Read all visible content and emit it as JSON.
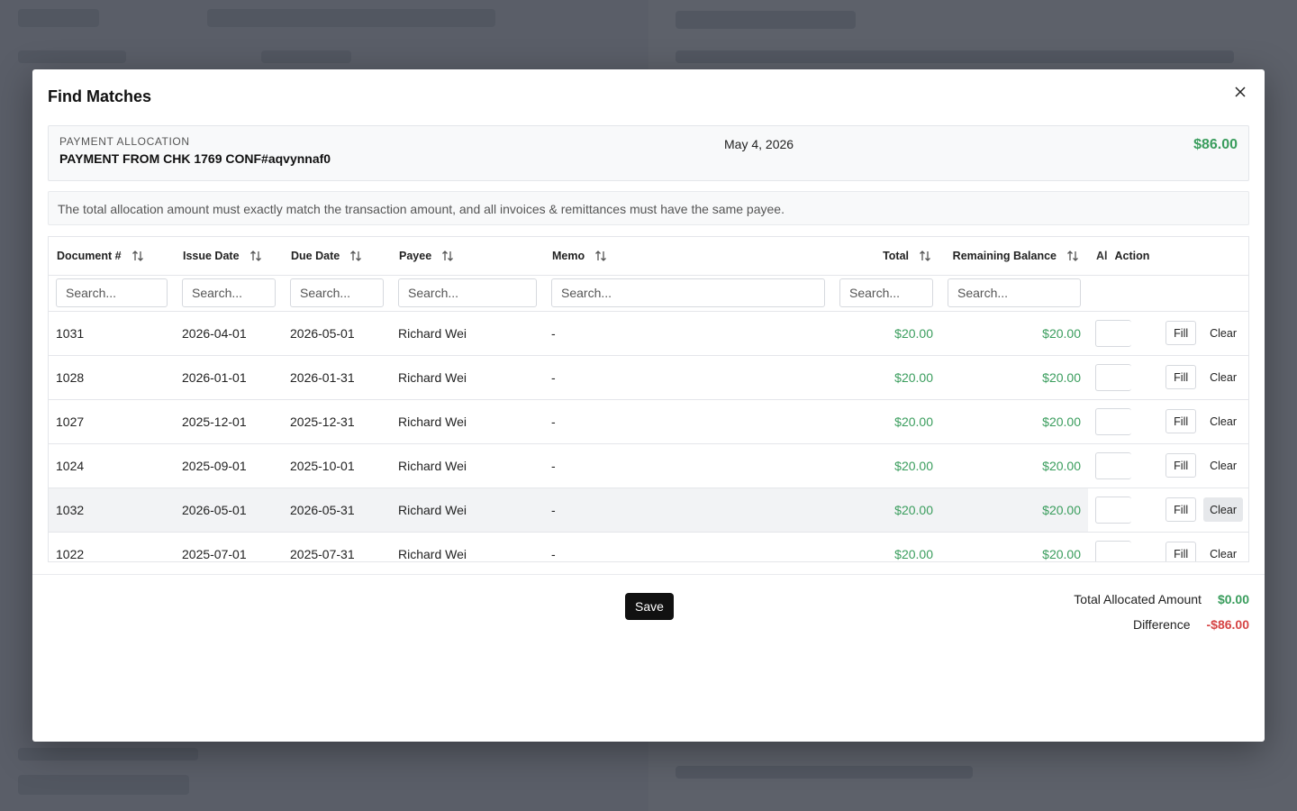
{
  "modal": {
    "title": "Find Matches"
  },
  "allocation": {
    "label": "PAYMENT ALLOCATION",
    "description": "PAYMENT FROM CHK 1769 CONF#aqvynnaf0",
    "date": "May 4, 2026",
    "amount": "$86.00"
  },
  "notice": "The total allocation amount must exactly match the transaction amount, and all invoices & remittances must have the same payee.",
  "table": {
    "columns": {
      "document": "Document #",
      "issue_date": "Issue Date",
      "due_date": "Due Date",
      "payee": "Payee",
      "memo": "Memo",
      "total": "Total",
      "remaining": "Remaining Balance",
      "allocated": "Al",
      "action": "Action"
    },
    "search_placeholder": "Search...",
    "fill_label": "Fill",
    "clear_label": "Clear",
    "rows": [
      {
        "doc": "1031",
        "issue": "2026-04-01",
        "due": "2026-05-01",
        "payee": "Richard Wei",
        "memo": "-",
        "total": "$20.00",
        "remaining": "$20.00"
      },
      {
        "doc": "1028",
        "issue": "2026-01-01",
        "due": "2026-01-31",
        "payee": "Richard Wei",
        "memo": "-",
        "total": "$20.00",
        "remaining": "$20.00"
      },
      {
        "doc": "1027",
        "issue": "2025-12-01",
        "due": "2025-12-31",
        "payee": "Richard Wei",
        "memo": "-",
        "total": "$20.00",
        "remaining": "$20.00"
      },
      {
        "doc": "1024",
        "issue": "2025-09-01",
        "due": "2025-10-01",
        "payee": "Richard Wei",
        "memo": "-",
        "total": "$20.00",
        "remaining": "$20.00"
      },
      {
        "doc": "1032",
        "issue": "2026-05-01",
        "due": "2026-05-31",
        "payee": "Richard Wei",
        "memo": "-",
        "total": "$20.00",
        "remaining": "$20.00"
      },
      {
        "doc": "1022",
        "issue": "2025-07-01",
        "due": "2025-07-31",
        "payee": "Richard Wei",
        "memo": "-",
        "total": "$20.00",
        "remaining": "$20.00"
      }
    ]
  },
  "footer": {
    "save_label": "Save",
    "total_allocated_label": "Total Allocated Amount",
    "total_allocated_value": "$0.00",
    "difference_label": "Difference",
    "difference_value": "-$86.00"
  },
  "colors": {
    "positive": "#3a9d5d",
    "negative": "#d64545"
  }
}
